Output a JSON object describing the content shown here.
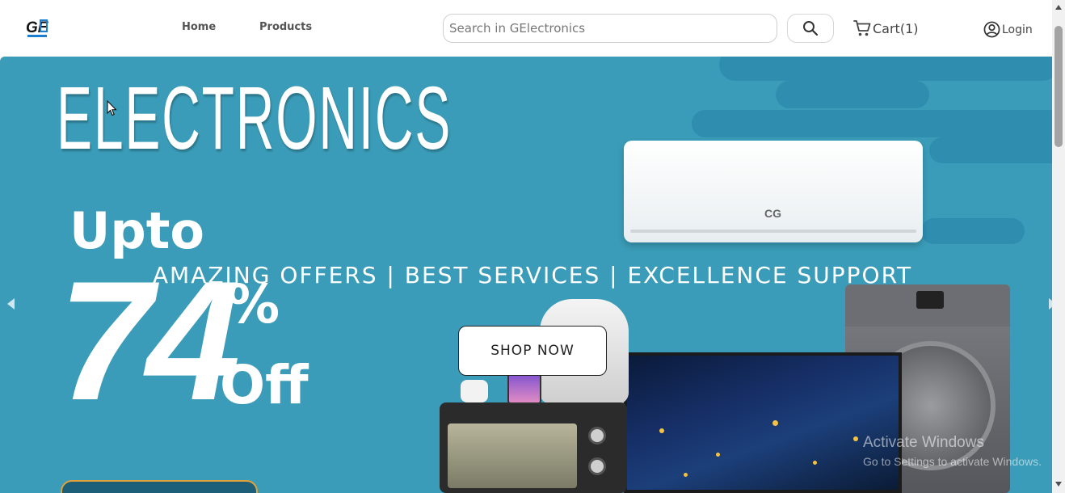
{
  "header": {
    "logo_text": "GE",
    "nav": {
      "home": "Home",
      "products": "Products"
    },
    "search": {
      "placeholder": "Search in GElectronics",
      "value": ""
    },
    "cart_label": "Cart(1)",
    "login_label": "Login"
  },
  "banner": {
    "title": "ELECTRONICS",
    "upto": "Upto",
    "discount_number": "74",
    "percent": "%",
    "off": "Off",
    "tagline": "AMAZING OFFERS | BEST SERVICES | EXCELLENCE SUPPORT",
    "cta_label": "SHOP NOW",
    "ac_brand": "CG"
  },
  "watermark": {
    "title": "Activate Windows",
    "subtitle": "Go to Settings to activate Windows."
  },
  "colors": {
    "banner_bg": "#3a9cb8",
    "stripe": "#2f8db0",
    "nav_text": "#555555"
  },
  "icons": [
    "logo",
    "search-icon",
    "cart-icon",
    "user-circle-icon",
    "chevron-left-icon",
    "chevron-right-icon"
  ]
}
